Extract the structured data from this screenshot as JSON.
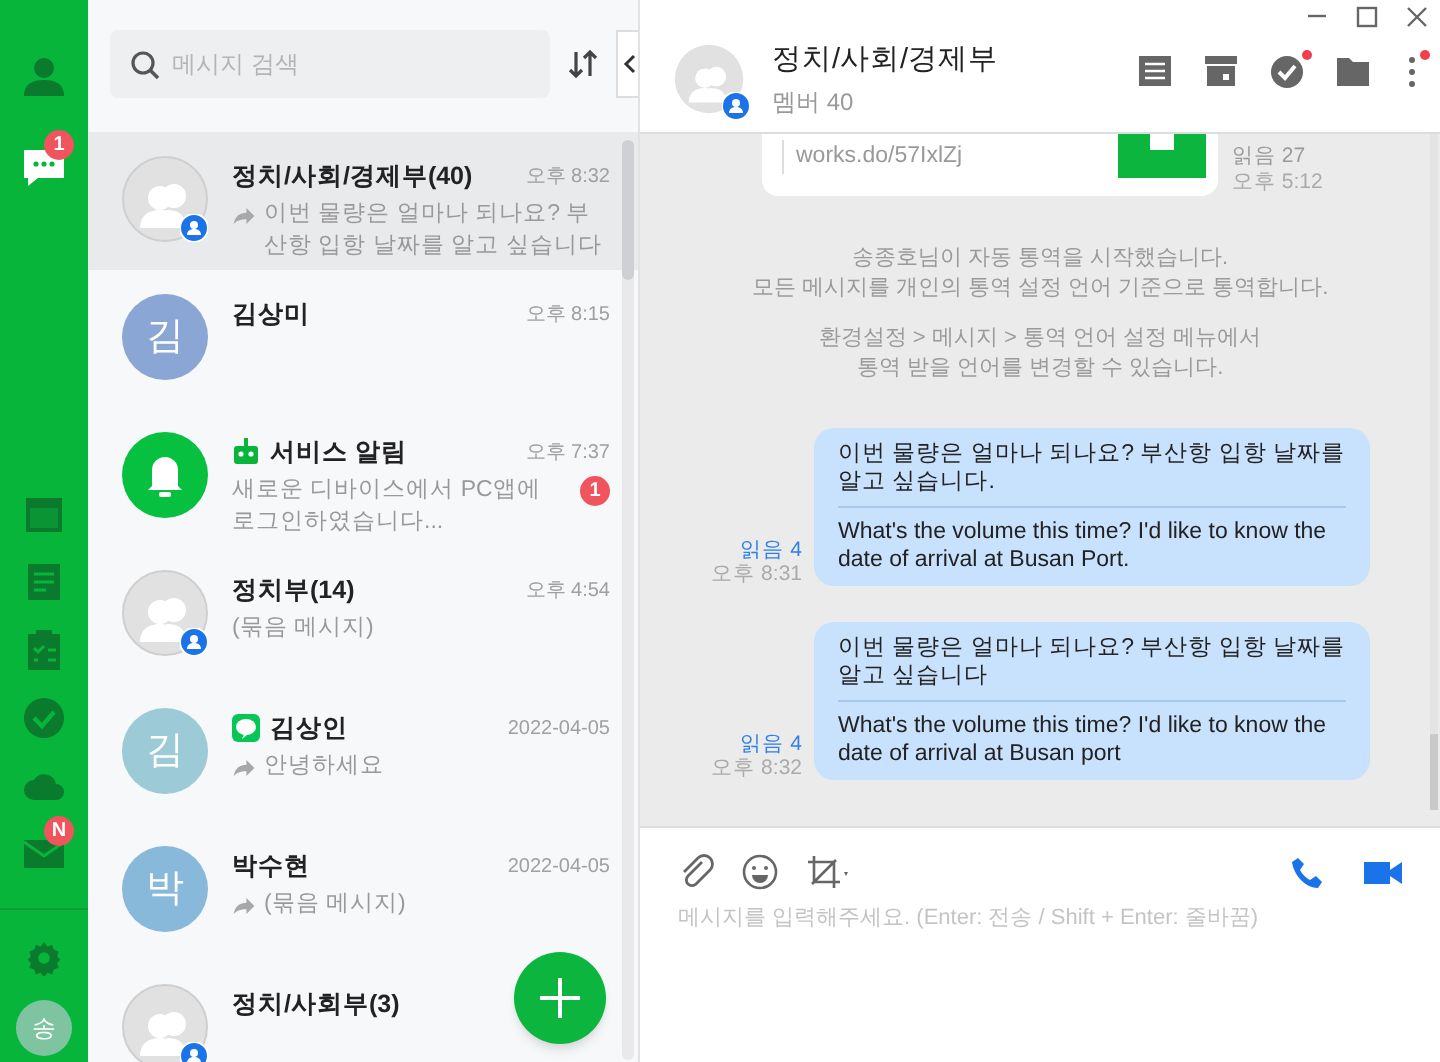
{
  "rail": {
    "top": [
      {
        "kind": "contacts",
        "selected": false
      },
      {
        "kind": "messages",
        "selected": true,
        "badge": "1"
      }
    ],
    "apps": [
      {
        "kind": "calendar",
        "selected": false
      },
      {
        "kind": "notes",
        "selected": false
      },
      {
        "kind": "tasks",
        "selected": false
      },
      {
        "kind": "approval",
        "selected": false
      },
      {
        "kind": "drive",
        "selected": false
      },
      {
        "kind": "mail",
        "selected": false,
        "badge": "N"
      }
    ],
    "bottom": {
      "profile_initial": "송"
    }
  },
  "chat_list": {
    "search": {
      "placeholder": "메시지 검색"
    },
    "conversations": [
      {
        "kind": "group",
        "name": "정치/사회/경제부(40)",
        "time": "오후 8:32",
        "preview": "이번 물량은 얼마나 되나요? 부산항 입항 날짜를 알고 싶습니다",
        "forwarded": true,
        "selected": true
      },
      {
        "kind": "contact",
        "name": "김상미",
        "time": "오후 8:15",
        "initial": "김",
        "color": "#8aa6d4",
        "forwarded": false,
        "selected": false
      },
      {
        "kind": "service",
        "name": "서비스 알림",
        "time": "오후 7:37",
        "preview": "새로운 디바이스에서 PC앱에 로그인하였습니다...",
        "app_icon": {
          "kind": "robot"
        },
        "badge": "1",
        "forwarded": false,
        "selected": false
      },
      {
        "kind": "group",
        "name": "정치부(14)",
        "time": "오후 4:54",
        "preview": "(묶음 메시지)",
        "forwarded": false,
        "selected": false
      },
      {
        "kind": "contact",
        "name": "김상인",
        "time": "2022-04-05",
        "preview": "안녕하세요",
        "initial": "김",
        "color": "#9ccad6",
        "app_icon": {
          "kind": "chat"
        },
        "forwarded": true,
        "selected": false
      },
      {
        "kind": "contact",
        "name": "박수현",
        "time": "2022-04-05",
        "preview": "(묶음 메시지)",
        "initial": "박",
        "color": "#88b8da",
        "forwarded": true,
        "selected": false
      },
      {
        "kind": "group",
        "name": "정치/사회부(3)",
        "forwarded": false,
        "selected": false
      }
    ]
  },
  "chat": {
    "title": "정치/사회/경제부",
    "subtitle": "멤버 40",
    "toolbar": [
      {
        "kind": "notes",
        "notify": false
      },
      {
        "kind": "archive",
        "notify": false
      },
      {
        "kind": "tasks",
        "notify": true
      },
      {
        "kind": "folder",
        "notify": false
      },
      {
        "kind": "more",
        "notify": true
      }
    ],
    "link_card": {
      "link": "works.do/57IxlZj",
      "read": "읽음 27",
      "time": "오후 5:12"
    },
    "notices": [
      "송종호님이 자동 통역을 시작했습니다.\n모든 메시지를 개인의 통역 설정 언어 기준으로 통역합니다.",
      "환경설정 > 메시지 > 통역 언어 설정 메뉴에서\n통역 받을 언어를 변경할 수 있습니다."
    ],
    "messages": [
      {
        "text": "이번 물량은 얼마나 되나요? 부산항 입항 날짜를 알고 싶습니다.",
        "translation": "What's the volume this time? I'd like to know the date of arrival at Busan Port.",
        "read": "읽음 4",
        "time": "오후 8:31"
      },
      {
        "text": "이번 물량은 얼마나 되나요? 부산항 입항 날짜를 알고 싶습니다",
        "translation": "What's the volume this time? I'd like to know the date of arrival at Busan port",
        "read": "읽음 4",
        "time": "오후 8:32"
      }
    ],
    "composer": {
      "placeholder": "메시지를 입력해주세요. (Enter: 전송 / Shift + Enter: 줄바꿈)"
    }
  }
}
